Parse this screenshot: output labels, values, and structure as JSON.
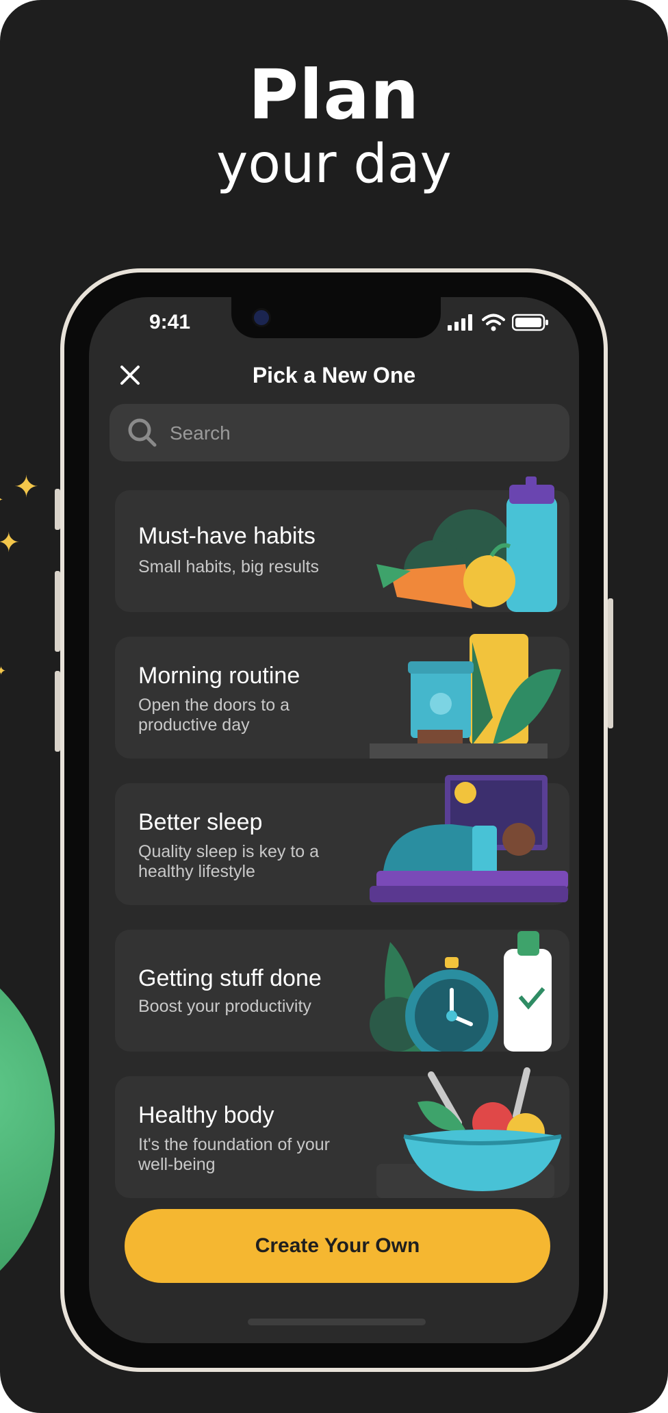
{
  "hero": {
    "title": "Plan",
    "subtitle": "your day"
  },
  "status_bar": {
    "time": "9:41"
  },
  "header": {
    "title": "Pick a New One"
  },
  "search": {
    "placeholder": "Search"
  },
  "cards": [
    {
      "title": "Must-have habits",
      "subtitle": "Small habits, big results"
    },
    {
      "title": "Morning routine",
      "subtitle": "Open the doors to a productive day"
    },
    {
      "title": "Better sleep",
      "subtitle": "Quality sleep is key to a healthy lifestyle"
    },
    {
      "title": "Getting stuff done",
      "subtitle": "Boost your productivity"
    },
    {
      "title": "Healthy body",
      "subtitle": "It's the foundation of your well-being"
    }
  ],
  "cta": {
    "label": "Create Your Own"
  },
  "colors": {
    "background": "#1e1e1e",
    "card": "#333333",
    "accent": "#f5b731",
    "text": "#ffffff"
  }
}
